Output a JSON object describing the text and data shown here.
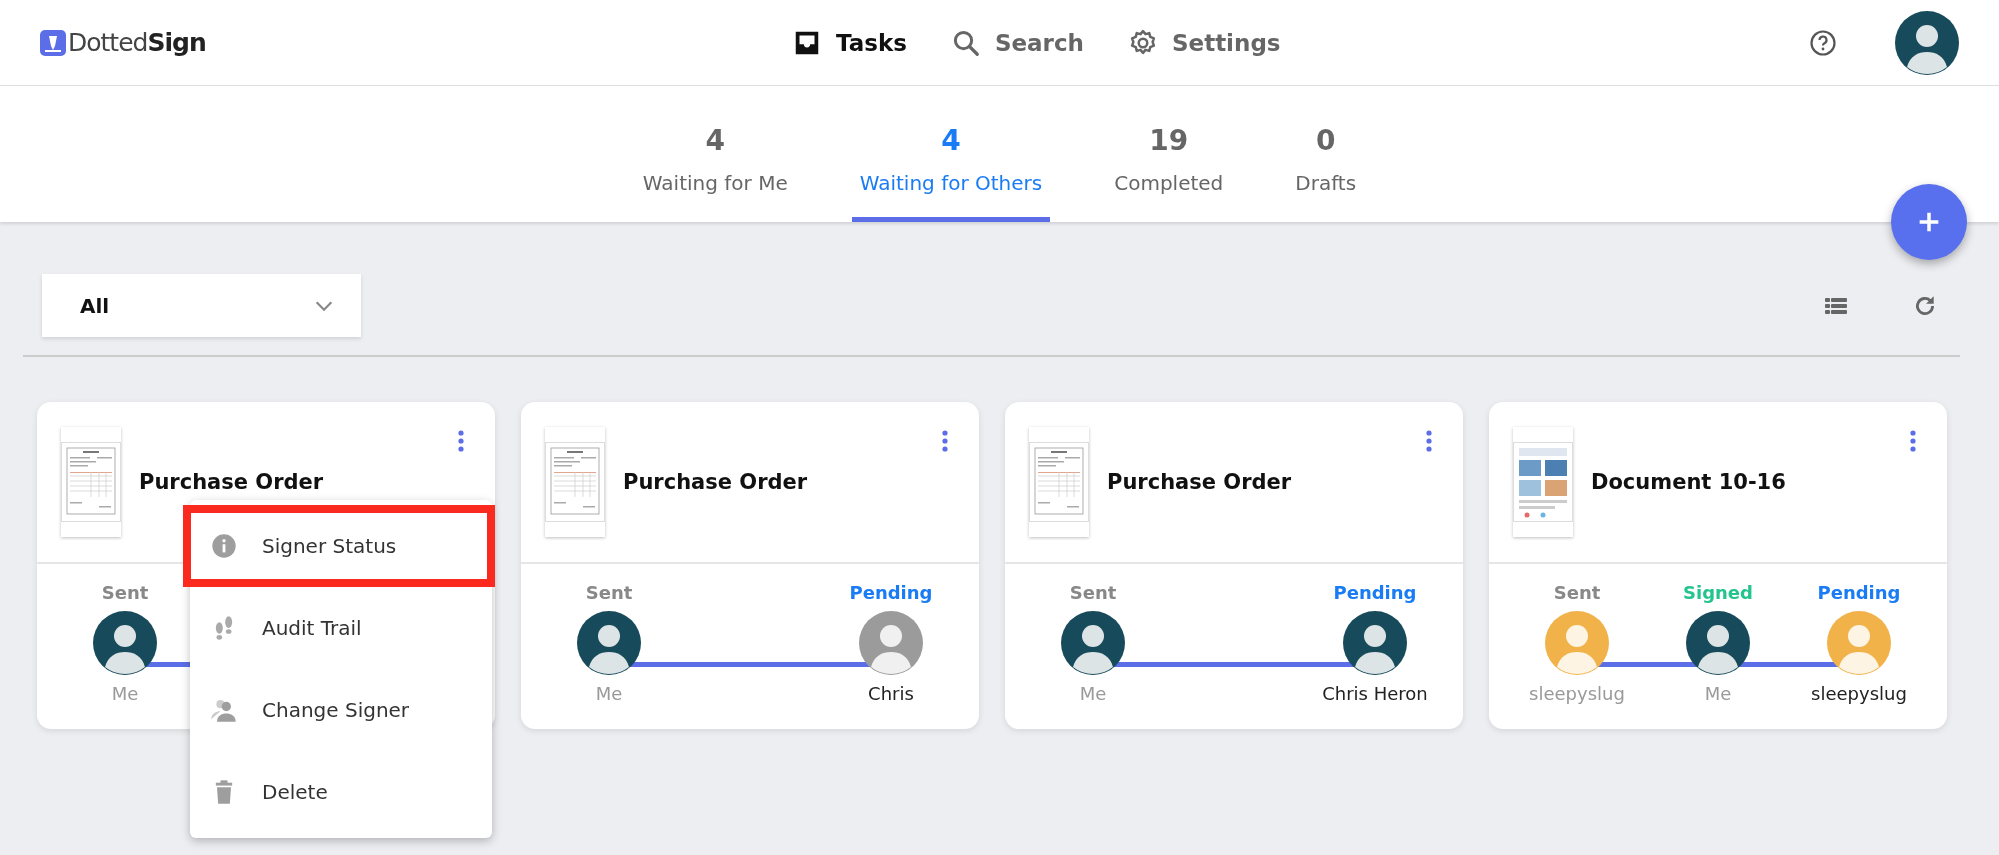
{
  "header": {
    "logo": {
      "text_plain": "Dotted",
      "text_bold": "Sign"
    },
    "nav": [
      {
        "label": "Tasks",
        "selected": true
      },
      {
        "label": "Search",
        "selected": false
      },
      {
        "label": "Settings",
        "selected": false
      }
    ]
  },
  "tabs": [
    {
      "count": "4",
      "label": "Waiting for Me",
      "selected": false
    },
    {
      "count": "4",
      "label": "Waiting for Others",
      "selected": true
    },
    {
      "count": "19",
      "label": "Completed",
      "selected": false
    },
    {
      "count": "0",
      "label": "Drafts",
      "selected": false
    }
  ],
  "filter": {
    "value": "All"
  },
  "cards": [
    {
      "title": "Purchase Order",
      "kind": "form",
      "signers": [
        {
          "status": "Sent",
          "kind": "sent",
          "name": "Me",
          "color": "#174a5a"
        }
      ]
    },
    {
      "title": "Purchase Order",
      "kind": "form",
      "signers": [
        {
          "status": "Sent",
          "kind": "sent",
          "name": "Me",
          "color": "#174a5a"
        },
        {
          "status": "Pending",
          "kind": "pending",
          "name": "Chris",
          "color": "#9b9b9b"
        }
      ]
    },
    {
      "title": "Purchase Order",
      "kind": "form",
      "signers": [
        {
          "status": "Sent",
          "kind": "sent",
          "name": "Me",
          "color": "#174a5a"
        },
        {
          "status": "Pending",
          "kind": "pending",
          "name": "Chris Heron",
          "color": "#174a5a"
        }
      ]
    },
    {
      "title": "Document 10-16",
      "kind": "photos",
      "signers": [
        {
          "status": "Sent",
          "kind": "sent",
          "name": "sleepyslug",
          "color": "#f2b24a"
        },
        {
          "status": "Signed",
          "kind": "signed",
          "name": "Me",
          "color": "#174a5a"
        },
        {
          "status": "Pending",
          "kind": "pending",
          "name": "sleepyslug",
          "color": "#f2b24a"
        }
      ]
    }
  ],
  "context_menu": {
    "items": [
      {
        "label": "Signer Status",
        "highlighted": true
      },
      {
        "label": "Audit Trail",
        "highlighted": false
      },
      {
        "label": "Change Signer",
        "highlighted": false
      },
      {
        "label": "Delete",
        "highlighted": false
      }
    ]
  }
}
